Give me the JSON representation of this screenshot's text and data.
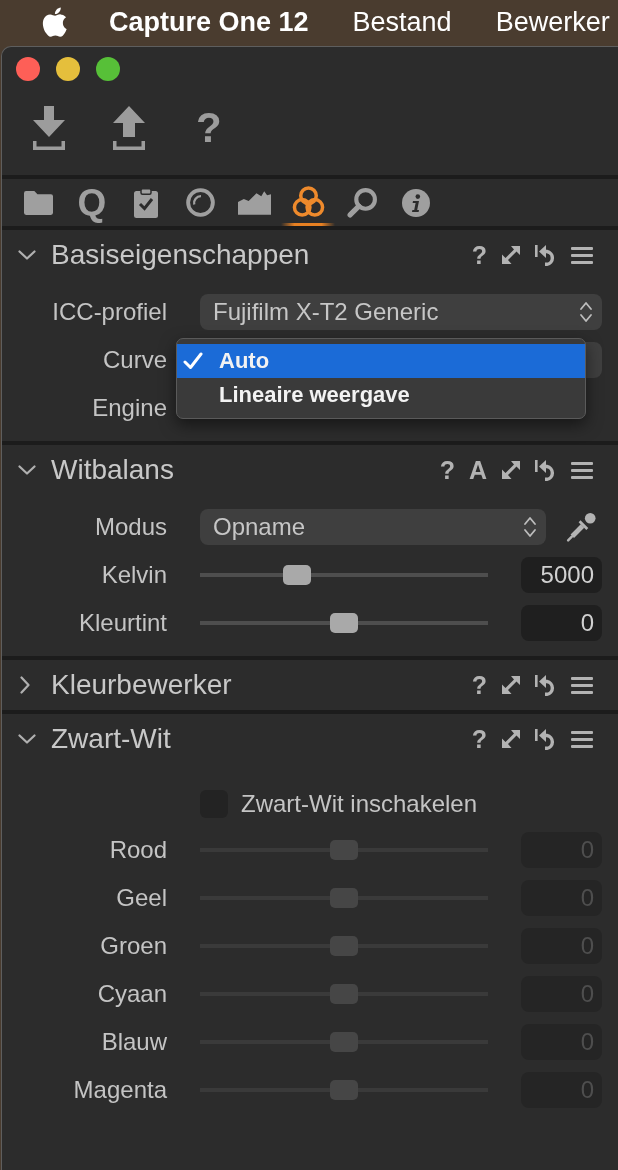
{
  "menu_bar": {
    "app_name": "Capture One 12",
    "menus": [
      "Bestand",
      "Bewerker"
    ]
  },
  "toolbar": [
    {
      "kind": "import"
    },
    {
      "kind": "export"
    },
    {
      "kind": "help",
      "glyph": "?"
    }
  ],
  "tabs": [
    {
      "kind": "folder",
      "selected": false
    },
    {
      "kind": "quick",
      "glyph": "Q",
      "selected": false
    },
    {
      "kind": "clipboard",
      "selected": false
    },
    {
      "kind": "lens",
      "selected": false
    },
    {
      "kind": "histogram",
      "selected": false
    },
    {
      "kind": "color",
      "selected": true
    },
    {
      "kind": "search",
      "selected": false
    },
    {
      "kind": "info",
      "selected": false
    }
  ],
  "sections": [
    {
      "title": "Basiseigenschappen",
      "expanded": true,
      "tools": [
        {
          "kind": "help",
          "glyph": "?"
        },
        {
          "kind": "expand"
        },
        {
          "kind": "reset"
        },
        {
          "kind": "menu"
        }
      ],
      "rows": [
        {
          "kind": "select",
          "label": "ICC-profiel",
          "value": "Fujifilm X-T2 Generic"
        },
        {
          "kind": "select",
          "label": "Curve",
          "menu": [
            {
              "label": "Auto",
              "selected": true
            },
            {
              "label": "Lineaire weergave",
              "selected": false
            }
          ]
        },
        {
          "kind": "label",
          "label": "Engine"
        }
      ]
    },
    {
      "title": "Witbalans",
      "expanded": true,
      "tools": [
        {
          "kind": "help",
          "glyph": "?"
        },
        {
          "kind": "auto",
          "glyph": "A"
        },
        {
          "kind": "expand"
        },
        {
          "kind": "reset"
        },
        {
          "kind": "menu"
        }
      ],
      "rows": [
        {
          "kind": "select",
          "label": "Modus",
          "value": "Opname",
          "eyedropper": true
        },
        {
          "kind": "slider",
          "label": "Kelvin",
          "level": 0.32,
          "value": "5000",
          "disabled": false
        },
        {
          "kind": "slider",
          "label": "Kleurtint",
          "level": 0.5,
          "value": "0",
          "disabled": false
        }
      ]
    },
    {
      "title": "Kleurbewerker",
      "expanded": false,
      "tools": [
        {
          "kind": "help",
          "glyph": "?"
        },
        {
          "kind": "expand"
        },
        {
          "kind": "reset"
        },
        {
          "kind": "menu"
        }
      ]
    },
    {
      "title": "Zwart-Wit",
      "expanded": true,
      "tools": [
        {
          "kind": "help",
          "glyph": "?"
        },
        {
          "kind": "expand"
        },
        {
          "kind": "reset"
        },
        {
          "kind": "menu"
        }
      ],
      "rows": [
        {
          "kind": "checkbox",
          "label": "Zwart-Wit inschakelen",
          "checked": false
        },
        {
          "kind": "slider",
          "label": "Rood",
          "level": 0.5,
          "value": "0",
          "disabled": true
        },
        {
          "kind": "slider",
          "label": "Geel",
          "level": 0.5,
          "value": "0",
          "disabled": true
        },
        {
          "kind": "slider",
          "label": "Groen",
          "level": 0.5,
          "value": "0",
          "disabled": true
        },
        {
          "kind": "slider",
          "label": "Cyaan",
          "level": 0.5,
          "value": "0",
          "disabled": true
        },
        {
          "kind": "slider",
          "label": "Blauw",
          "level": 0.5,
          "value": "0",
          "disabled": true
        },
        {
          "kind": "slider",
          "label": "Magenta",
          "level": 0.5,
          "value": "0",
          "disabled": true
        }
      ]
    }
  ]
}
